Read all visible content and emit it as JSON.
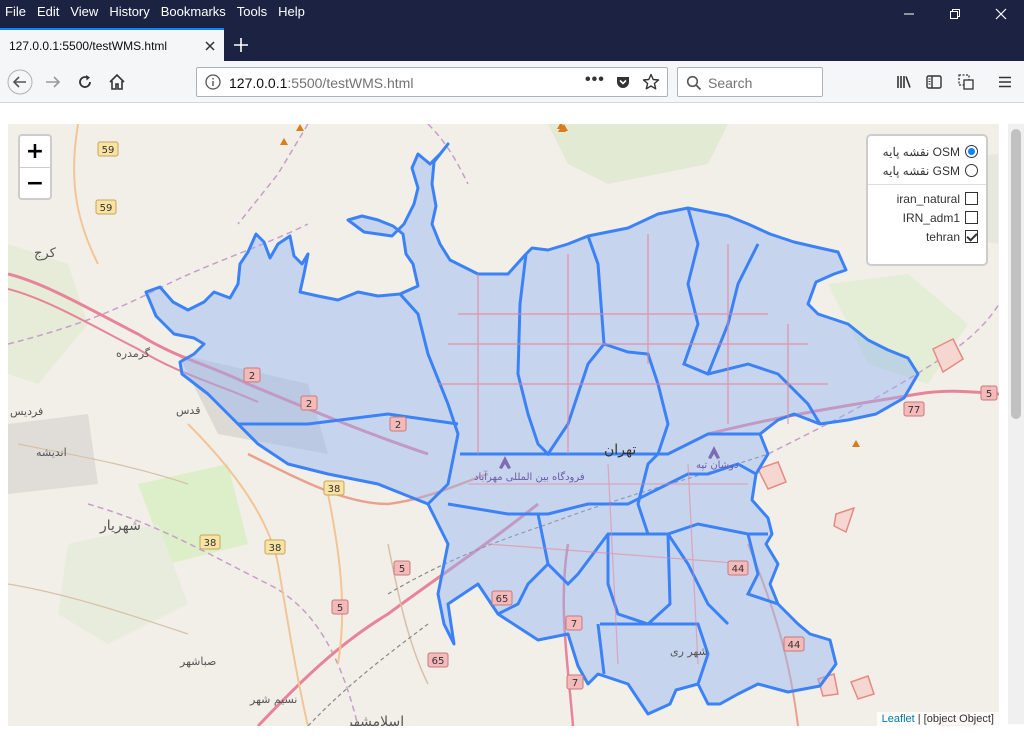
{
  "menu": {
    "items": [
      "File",
      "Edit",
      "View",
      "History",
      "Bookmarks",
      "Tools",
      "Help"
    ]
  },
  "tab": {
    "title": "127.0.0.1:5500/testWMS.html"
  },
  "navbar": {
    "url_host": "127.0.0.1",
    "url_path": ":5500/testWMS.html",
    "search_placeholder": "Search"
  },
  "map": {
    "zoom_in": "+",
    "zoom_out": "−",
    "base_layers": [
      {
        "label": "نقشه پایه OSM",
        "selected": true
      },
      {
        "label": "نقشه پایه GSM",
        "selected": false
      }
    ],
    "overlays": [
      {
        "label": "iran_natural",
        "checked": false
      },
      {
        "label": "IRN_adm1",
        "checked": false
      },
      {
        "label": "tehran",
        "checked": true
      }
    ],
    "attribution_link": "Leaflet",
    "attribution_sep": "|",
    "attribution_text": "[object Object]",
    "place_labels": [
      "کرج",
      "گرمدره",
      "قدس",
      "اندیشه",
      "شهریار",
      "صباشهر",
      "نسیم شهر",
      "اسلامشهر",
      "تهران",
      "دوشان تپه",
      "شهر ری",
      "فرودگاه بین المللی مهرآباد",
      "فردیس"
    ],
    "road_shields": [
      "59",
      "59",
      "2",
      "2",
      "2",
      "38",
      "38",
      "38",
      "5",
      "5",
      "65",
      "65",
      "7",
      "7",
      "44",
      "44",
      "77",
      "5"
    ]
  },
  "colors": {
    "chrome_dark": "#1c2342",
    "tab_accent": "#0a84ff",
    "district_stroke": "#3b82f6",
    "district_fill": "#93b4f5"
  }
}
